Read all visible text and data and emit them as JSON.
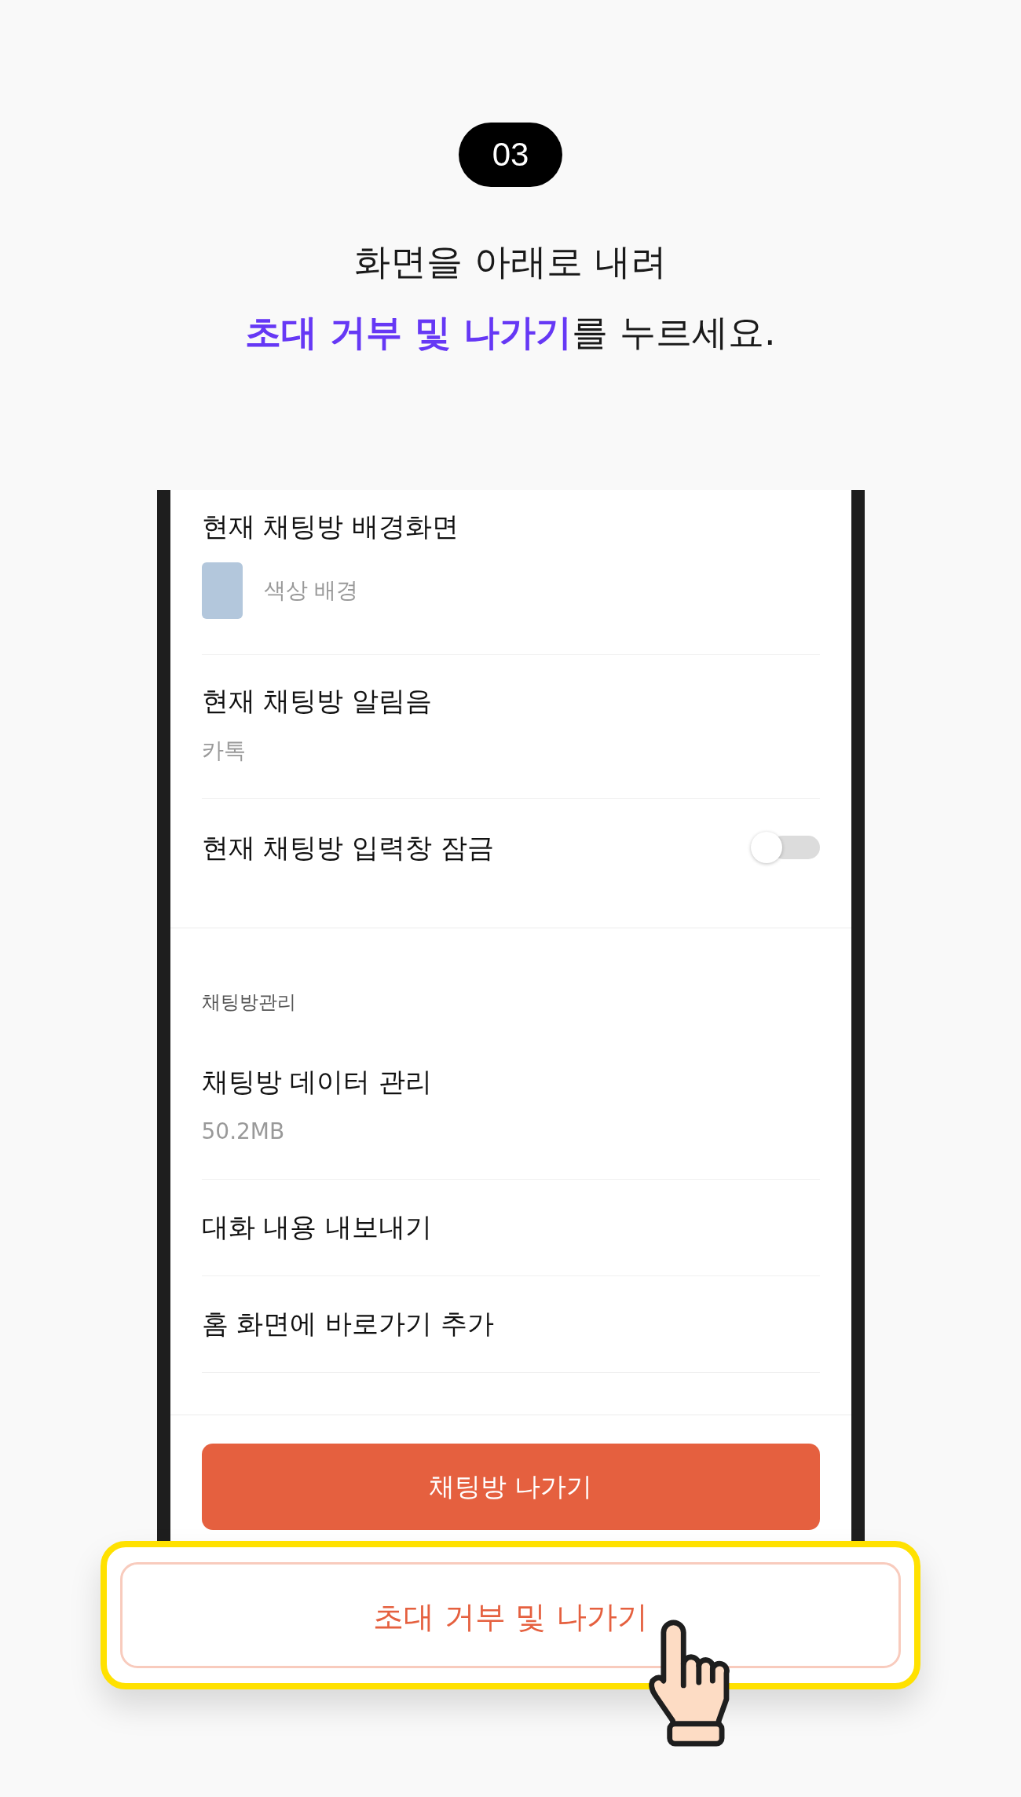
{
  "step_badge": "03",
  "headline": [
    "화면을 아래로 내려",
    "**초대 거부 및 나가기**를 누르세요."
  ],
  "phone": {
    "settings": [
      {
        "kind": "swatch",
        "title": "현재 채팅방 배경화면",
        "value": "색상 배경",
        "color": "#b3c7dc"
      },
      {
        "kind": "value",
        "title": "현재 채팅방 알림음",
        "value": "카톡"
      },
      {
        "kind": "toggle",
        "title": "현재 채팅방 입력창 잠금",
        "on": false
      }
    ],
    "chat_room_management": {
      "header": "채팅방관리",
      "items": [
        {
          "kind": "value",
          "title": "채팅방 데이터 관리",
          "value": "50.2MB"
        },
        {
          "kind": "plain",
          "title": "대화 내용 내보내기"
        },
        {
          "kind": "plain",
          "title": "홈 화면에 바로가기 추가"
        }
      ]
    },
    "leave_button": "채팅방 나가기"
  },
  "callout": {
    "button": "초대 거부 및 나가기"
  }
}
